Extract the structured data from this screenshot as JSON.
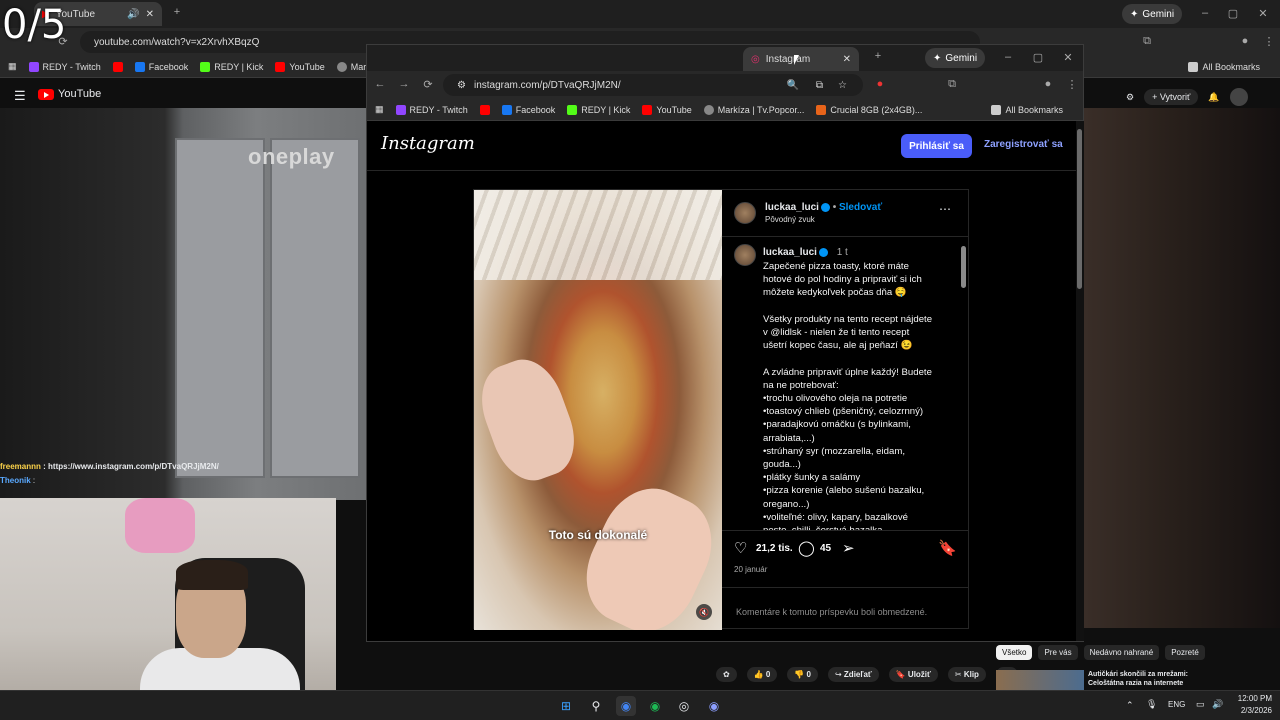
{
  "counter": "0/5",
  "back_browser": {
    "tab_title": "YouTube",
    "url": "youtube.com/watch?v=x2XrvhXBqzQ",
    "gemini_label": "Gemini",
    "bookmarks": [
      "REDY - Twitch",
      "Facebook",
      "REDY | Kick",
      "YouTube",
      "Markíza |"
    ],
    "all_bookmarks": "All Bookmarks"
  },
  "youtube": {
    "logo_text": "YouTube",
    "create_label": "Vytvoriť",
    "watermark": "oneplay",
    "actions": {
      "likes": "0",
      "dislikes": "0",
      "share": "Zdieľať",
      "save": "Uložiť",
      "clip": "Klip"
    },
    "chips": [
      "Všetko",
      "Pre vás",
      "Nedávno nahrané",
      "Pozreté"
    ],
    "side_title": "Autičkári skončili za mrežami: Celoštátna razia na internete"
  },
  "chat": [
    {
      "user": "freemannn",
      "text": "https://www.instagram.com/p/DTvaQRJjM2N/"
    },
    {
      "user": "Theonik",
      "text": ""
    }
  ],
  "front_browser": {
    "tab_title": "Instagram",
    "url": "instagram.com/p/DTvaQRJjM2N/",
    "gemini_label": "Gemini",
    "bookmarks": [
      "REDY - Twitch",
      "Facebook",
      "REDY | Kick",
      "YouTube",
      "Markíza | Tv.Popcor...",
      "Crucial 8GB (2x4GB)..."
    ],
    "all_bookmarks": "All Bookmarks"
  },
  "instagram": {
    "logo": "Instagram",
    "login": "Prihlásiť sa",
    "register": "Zaregistrovať sa",
    "post": {
      "username": "luckaa_luci",
      "follow": "Sledovať",
      "audio": "Pôvodný zvuk",
      "age": "1 t",
      "caption": "Zapečené pizza toasty, ktoré máte\nhotové do pol hodiny a pripraviť si ich\nmôžete kedykoľvek počas dňa 🤤\n\nVšetky produkty na tento recept nájdete\nv @lidlsk - nielen že ti tento recept\nušetrí kopec času, ale aj peňazí 😉\n\nA zvládne pripraviť úplne každý! Budete\nna ne potrebovať:\n•trochu olivového oleja na potretie\n•toastový chlieb (pšeničný, celozrnný)\n•paradajkovú omáčku (s bylinkami,\narrabiata,...)\n•strúhaný syr (mozzarella, eidam,\ngouda...)\n•plátky šunky a salámy\n•pizza korenie (alebo sušenú bazalku,\noregano...)\n•voliteľné: olivy, kapary, bazalkové\npesto, chilli, čerstvá bazalka",
      "overlay_text": "Toto sú dokonalé",
      "likes": "21,2 tis.",
      "comments": "45",
      "date": "20 január",
      "comments_disabled": "Komentáre k tomuto príspevku boli obmedzené."
    }
  },
  "taskbar": {
    "lang": "ENG",
    "time": "12:00 PM",
    "date": "2/3/2026"
  }
}
